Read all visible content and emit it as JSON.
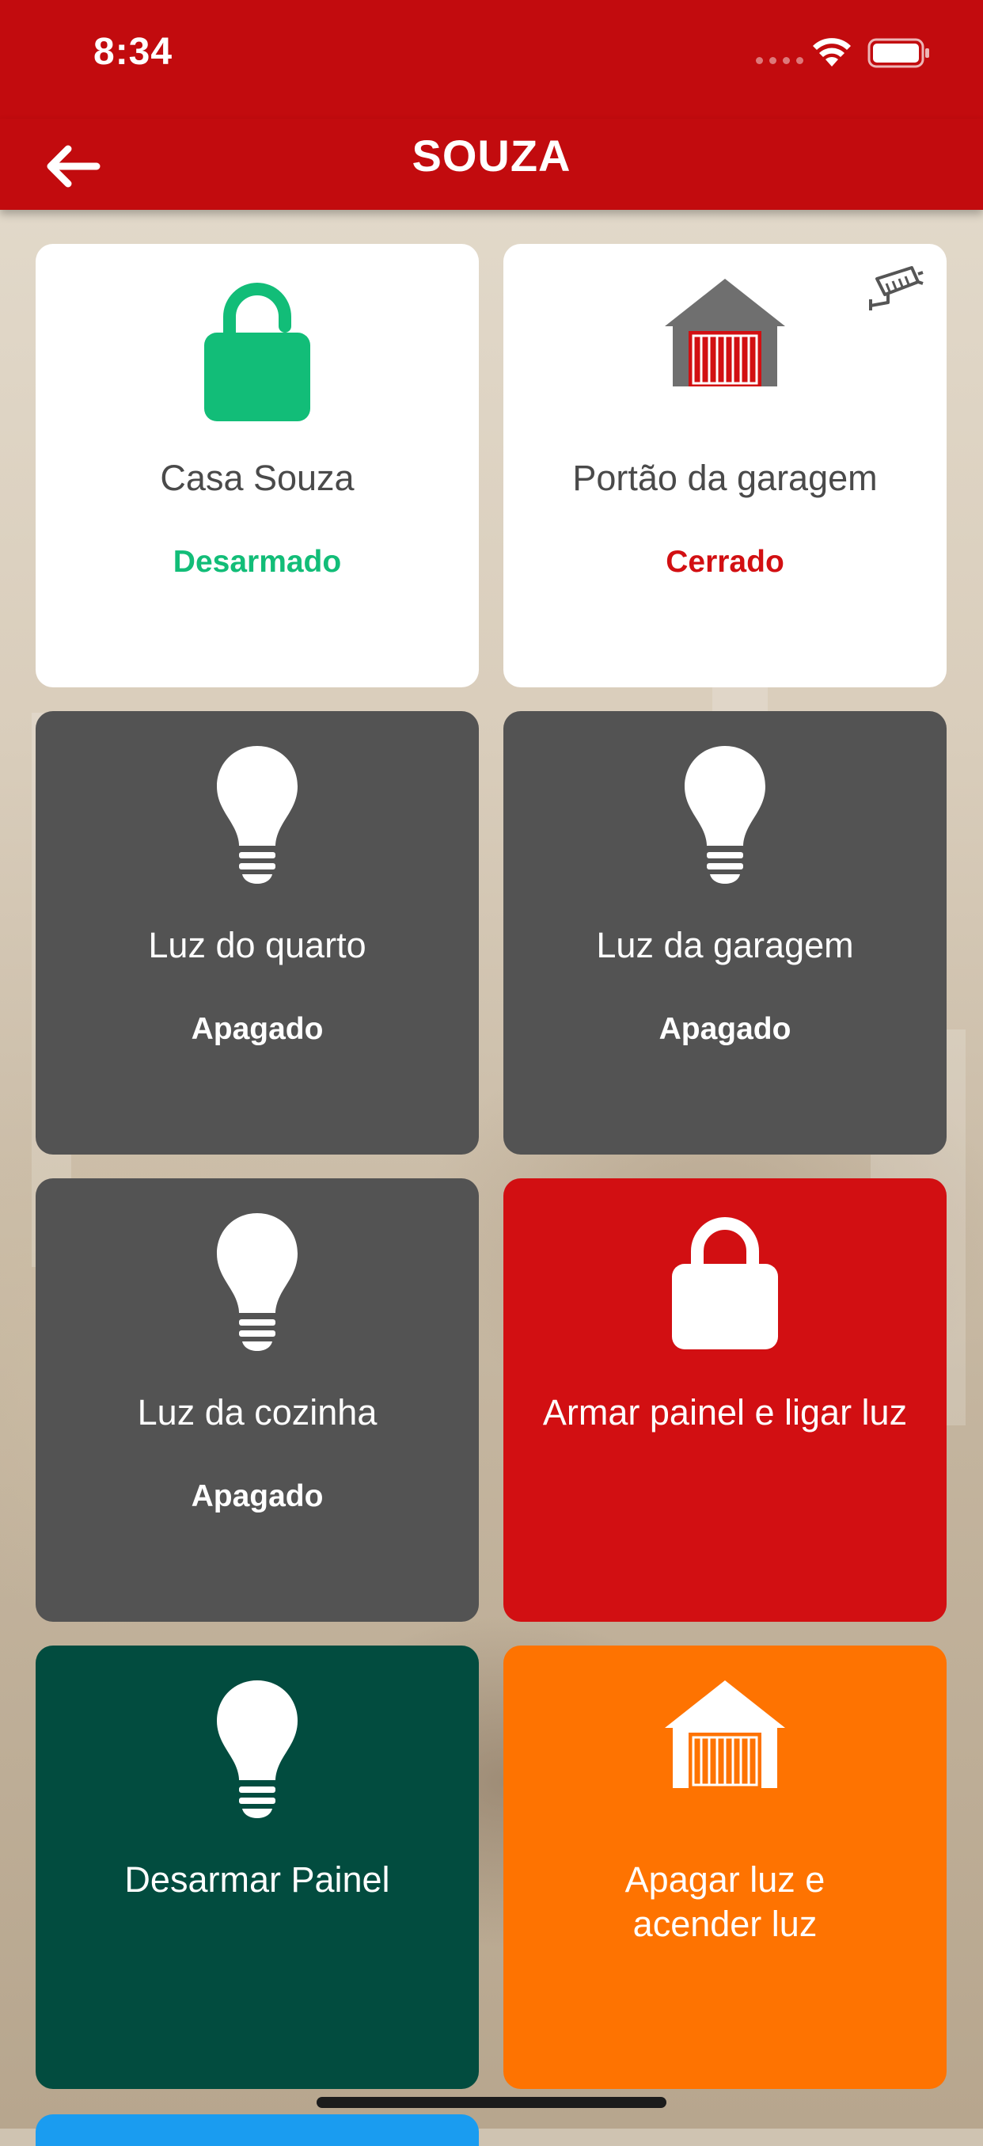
{
  "status_bar": {
    "time": "8:34"
  },
  "nav": {
    "title": "SOUZA",
    "back_icon": "arrow-left-icon"
  },
  "colors": {
    "header_red": "#c20b0e",
    "armed_green": "#12bd78",
    "closed_red": "#d20f12",
    "tile_grey": "#535353",
    "tile_red": "#d20f12",
    "tile_dark_green": "#024c3f",
    "tile_orange": "#fe7301"
  },
  "tiles": [
    {
      "label": "Casa Souza",
      "state": "Desarmado",
      "icon": "unlocked-padlock-icon"
    },
    {
      "label": "Portão da garagem",
      "state": "Cerrado",
      "icon": "garage-icon",
      "badge_icon": "security-camera-icon"
    },
    {
      "label": "Luz do quarto",
      "state": "Apagado",
      "icon": "light-bulb-icon"
    },
    {
      "label": "Luz da garagem",
      "state": "Apagado",
      "icon": "light-bulb-icon"
    },
    {
      "label": "Luz da cozinha",
      "state": "Apagado",
      "icon": "light-bulb-icon"
    },
    {
      "label": "Armar painel e ligar luz",
      "icon": "locked-padlock-icon"
    },
    {
      "label": "Desarmar Painel",
      "icon": "light-bulb-icon"
    },
    {
      "label": "Apagar luz e acender luz",
      "icon": "garage-icon"
    }
  ]
}
